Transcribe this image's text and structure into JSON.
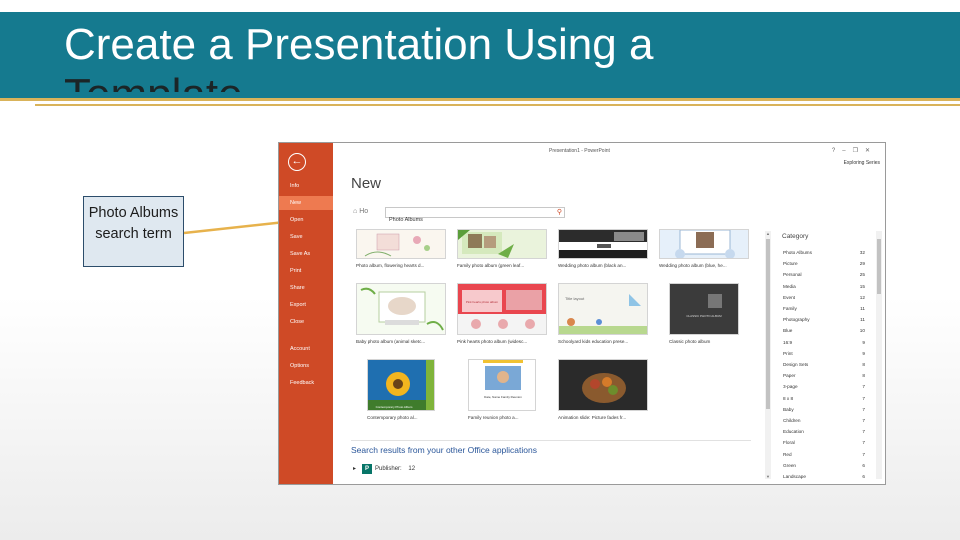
{
  "slide": {
    "title_line1": "Create a Presentation Using a",
    "title_line2": "Template",
    "callout": "Photo Albums search term",
    "colors": {
      "title_bar": "#157a8f",
      "gold": "#d9b35a",
      "backstage": "#cf4a26",
      "backstage_active": "#ee7a50"
    }
  },
  "app": {
    "window_title": "Presentation1 - PowerPoint",
    "window_controls": [
      "?",
      "–",
      "❐",
      "✕"
    ],
    "user": "Exploring Series",
    "back_icon": "back-arrow-icon",
    "nav": [
      "Info",
      "New",
      "Open",
      "Save",
      "Save As",
      "Print",
      "Share",
      "Export",
      "Close",
      "Account",
      "Options",
      "Feedback"
    ],
    "active_nav": "New",
    "heading": "New",
    "home_label": "Ho",
    "search_value": "Photo Albums",
    "templates": [
      "Photo album, flowering hearts d...",
      "Family photo album (green leaf...",
      "Wedding photo album (black an...",
      "Wedding photo album (blue, he...",
      "Baby photo album (animal sketc...",
      "Pink hearts photo album (widesc...",
      "Schoolyard kids education prese...",
      "Classic photo album",
      "Contemporary photo al...",
      "Family reunion photo a...",
      "Animation slide: Picture fades fr..."
    ],
    "thumb_texts": {
      "pink_hearts": "Pink hearts photo album",
      "schoolyard": "Title layout",
      "classic": "CLASSIC PHOTO ALBUM",
      "contemporary": "Contemporary Photo Album",
      "family_reunion": "Date, Name Family Reunion"
    },
    "results_heading": "Search results from your other Office applications",
    "publisher_label": "Publisher:",
    "publisher_count": "12",
    "category_heading": "Category",
    "categories": [
      {
        "name": "Photo Albums",
        "count": "32"
      },
      {
        "name": "Picture",
        "count": "29"
      },
      {
        "name": "Personal",
        "count": "25"
      },
      {
        "name": "Media",
        "count": "15"
      },
      {
        "name": "Event",
        "count": "12"
      },
      {
        "name": "Family",
        "count": "11"
      },
      {
        "name": "Photography",
        "count": "11"
      },
      {
        "name": "Blue",
        "count": "10"
      },
      {
        "name": "16:9",
        "count": "9"
      },
      {
        "name": "Print",
        "count": "9"
      },
      {
        "name": "Design Sets",
        "count": "8"
      },
      {
        "name": "Paper",
        "count": "8"
      },
      {
        "name": "3-page",
        "count": "7"
      },
      {
        "name": "8 x 8",
        "count": "7"
      },
      {
        "name": "Baby",
        "count": "7"
      },
      {
        "name": "Children",
        "count": "7"
      },
      {
        "name": "Education",
        "count": "7"
      },
      {
        "name": "Floral",
        "count": "7"
      },
      {
        "name": "Red",
        "count": "7"
      },
      {
        "name": "Green",
        "count": "6"
      },
      {
        "name": "Landscape",
        "count": "6"
      }
    ]
  }
}
